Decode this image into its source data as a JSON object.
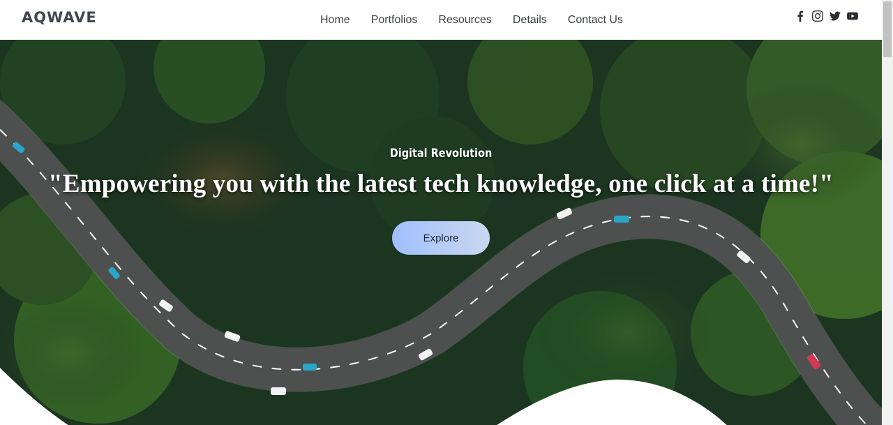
{
  "brand": {
    "logo_text": "AQWAVE"
  },
  "nav": {
    "items": [
      {
        "label": "Home"
      },
      {
        "label": "Portfolios"
      },
      {
        "label": "Resources"
      },
      {
        "label": "Details"
      },
      {
        "label": "Contact Us"
      }
    ]
  },
  "social": {
    "icons": [
      "facebook-icon",
      "instagram-icon",
      "twitter-icon",
      "youtube-icon"
    ]
  },
  "hero": {
    "eyebrow": "Digital Revolution",
    "headline": "\"Empowering you with the latest tech knowledge, one click at a time!\"",
    "cta_label": "Explore"
  },
  "colors": {
    "header_bg": "#ffffff",
    "nav_text": "#3a3f45",
    "logo_text": "#3f4650",
    "forest_dark": "#1f3a22",
    "road": "#2c2f2e",
    "cta_gradient_start": "#9fc0ff",
    "cta_gradient_end": "#c9d8f0"
  }
}
